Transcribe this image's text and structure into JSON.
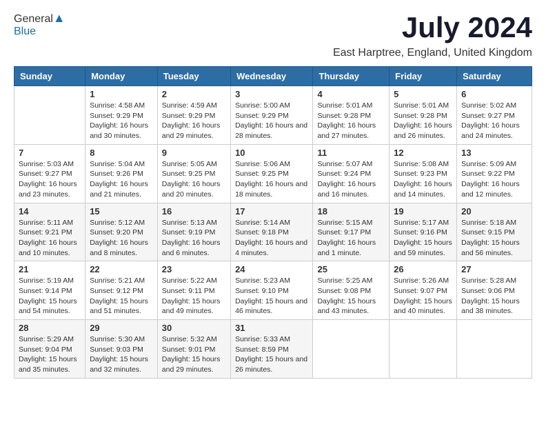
{
  "header": {
    "logo_general": "General",
    "logo_blue": "Blue",
    "month": "July 2024",
    "location": "East Harptree, England, United Kingdom"
  },
  "days_of_week": [
    "Sunday",
    "Monday",
    "Tuesday",
    "Wednesday",
    "Thursday",
    "Friday",
    "Saturday"
  ],
  "weeks": [
    [
      {
        "day": "",
        "sunrise": "",
        "sunset": "",
        "daylight": ""
      },
      {
        "day": "1",
        "sunrise": "Sunrise: 4:58 AM",
        "sunset": "Sunset: 9:29 PM",
        "daylight": "Daylight: 16 hours and 30 minutes."
      },
      {
        "day": "2",
        "sunrise": "Sunrise: 4:59 AM",
        "sunset": "Sunset: 9:29 PM",
        "daylight": "Daylight: 16 hours and 29 minutes."
      },
      {
        "day": "3",
        "sunrise": "Sunrise: 5:00 AM",
        "sunset": "Sunset: 9:29 PM",
        "daylight": "Daylight: 16 hours and 28 minutes."
      },
      {
        "day": "4",
        "sunrise": "Sunrise: 5:01 AM",
        "sunset": "Sunset: 9:28 PM",
        "daylight": "Daylight: 16 hours and 27 minutes."
      },
      {
        "day": "5",
        "sunrise": "Sunrise: 5:01 AM",
        "sunset": "Sunset: 9:28 PM",
        "daylight": "Daylight: 16 hours and 26 minutes."
      },
      {
        "day": "6",
        "sunrise": "Sunrise: 5:02 AM",
        "sunset": "Sunset: 9:27 PM",
        "daylight": "Daylight: 16 hours and 24 minutes."
      }
    ],
    [
      {
        "day": "7",
        "sunrise": "Sunrise: 5:03 AM",
        "sunset": "Sunset: 9:27 PM",
        "daylight": "Daylight: 16 hours and 23 minutes."
      },
      {
        "day": "8",
        "sunrise": "Sunrise: 5:04 AM",
        "sunset": "Sunset: 9:26 PM",
        "daylight": "Daylight: 16 hours and 21 minutes."
      },
      {
        "day": "9",
        "sunrise": "Sunrise: 5:05 AM",
        "sunset": "Sunset: 9:25 PM",
        "daylight": "Daylight: 16 hours and 20 minutes."
      },
      {
        "day": "10",
        "sunrise": "Sunrise: 5:06 AM",
        "sunset": "Sunset: 9:25 PM",
        "daylight": "Daylight: 16 hours and 18 minutes."
      },
      {
        "day": "11",
        "sunrise": "Sunrise: 5:07 AM",
        "sunset": "Sunset: 9:24 PM",
        "daylight": "Daylight: 16 hours and 16 minutes."
      },
      {
        "day": "12",
        "sunrise": "Sunrise: 5:08 AM",
        "sunset": "Sunset: 9:23 PM",
        "daylight": "Daylight: 16 hours and 14 minutes."
      },
      {
        "day": "13",
        "sunrise": "Sunrise: 5:09 AM",
        "sunset": "Sunset: 9:22 PM",
        "daylight": "Daylight: 16 hours and 12 minutes."
      }
    ],
    [
      {
        "day": "14",
        "sunrise": "Sunrise: 5:11 AM",
        "sunset": "Sunset: 9:21 PM",
        "daylight": "Daylight: 16 hours and 10 minutes."
      },
      {
        "day": "15",
        "sunrise": "Sunrise: 5:12 AM",
        "sunset": "Sunset: 9:20 PM",
        "daylight": "Daylight: 16 hours and 8 minutes."
      },
      {
        "day": "16",
        "sunrise": "Sunrise: 5:13 AM",
        "sunset": "Sunset: 9:19 PM",
        "daylight": "Daylight: 16 hours and 6 minutes."
      },
      {
        "day": "17",
        "sunrise": "Sunrise: 5:14 AM",
        "sunset": "Sunset: 9:18 PM",
        "daylight": "Daylight: 16 hours and 4 minutes."
      },
      {
        "day": "18",
        "sunrise": "Sunrise: 5:15 AM",
        "sunset": "Sunset: 9:17 PM",
        "daylight": "Daylight: 16 hours and 1 minute."
      },
      {
        "day": "19",
        "sunrise": "Sunrise: 5:17 AM",
        "sunset": "Sunset: 9:16 PM",
        "daylight": "Daylight: 15 hours and 59 minutes."
      },
      {
        "day": "20",
        "sunrise": "Sunrise: 5:18 AM",
        "sunset": "Sunset: 9:15 PM",
        "daylight": "Daylight: 15 hours and 56 minutes."
      }
    ],
    [
      {
        "day": "21",
        "sunrise": "Sunrise: 5:19 AM",
        "sunset": "Sunset: 9:14 PM",
        "daylight": "Daylight: 15 hours and 54 minutes."
      },
      {
        "day": "22",
        "sunrise": "Sunrise: 5:21 AM",
        "sunset": "Sunset: 9:12 PM",
        "daylight": "Daylight: 15 hours and 51 minutes."
      },
      {
        "day": "23",
        "sunrise": "Sunrise: 5:22 AM",
        "sunset": "Sunset: 9:11 PM",
        "daylight": "Daylight: 15 hours and 49 minutes."
      },
      {
        "day": "24",
        "sunrise": "Sunrise: 5:23 AM",
        "sunset": "Sunset: 9:10 PM",
        "daylight": "Daylight: 15 hours and 46 minutes."
      },
      {
        "day": "25",
        "sunrise": "Sunrise: 5:25 AM",
        "sunset": "Sunset: 9:08 PM",
        "daylight": "Daylight: 15 hours and 43 minutes."
      },
      {
        "day": "26",
        "sunrise": "Sunrise: 5:26 AM",
        "sunset": "Sunset: 9:07 PM",
        "daylight": "Daylight: 15 hours and 40 minutes."
      },
      {
        "day": "27",
        "sunrise": "Sunrise: 5:28 AM",
        "sunset": "Sunset: 9:06 PM",
        "daylight": "Daylight: 15 hours and 38 minutes."
      }
    ],
    [
      {
        "day": "28",
        "sunrise": "Sunrise: 5:29 AM",
        "sunset": "Sunset: 9:04 PM",
        "daylight": "Daylight: 15 hours and 35 minutes."
      },
      {
        "day": "29",
        "sunrise": "Sunrise: 5:30 AM",
        "sunset": "Sunset: 9:03 PM",
        "daylight": "Daylight: 15 hours and 32 minutes."
      },
      {
        "day": "30",
        "sunrise": "Sunrise: 5:32 AM",
        "sunset": "Sunset: 9:01 PM",
        "daylight": "Daylight: 15 hours and 29 minutes."
      },
      {
        "day": "31",
        "sunrise": "Sunrise: 5:33 AM",
        "sunset": "Sunset: 8:59 PM",
        "daylight": "Daylight: 15 hours and 26 minutes."
      },
      {
        "day": "",
        "sunrise": "",
        "sunset": "",
        "daylight": ""
      },
      {
        "day": "",
        "sunrise": "",
        "sunset": "",
        "daylight": ""
      },
      {
        "day": "",
        "sunrise": "",
        "sunset": "",
        "daylight": ""
      }
    ]
  ]
}
